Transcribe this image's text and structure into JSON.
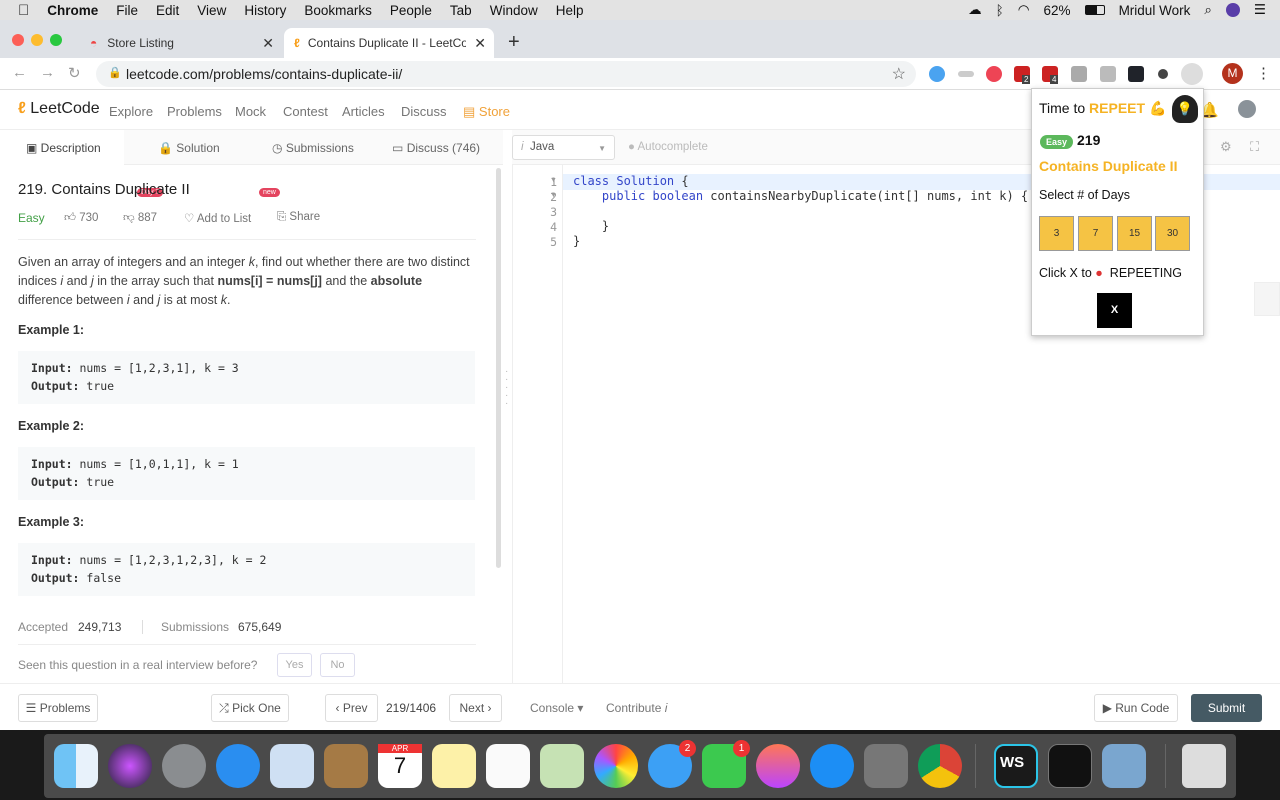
{
  "menubar": {
    "app": "Chrome",
    "items": [
      "File",
      "Edit",
      "View",
      "History",
      "Bookmarks",
      "People",
      "Tab",
      "Window",
      "Help"
    ],
    "battery": "62%",
    "user": "Mridul Work"
  },
  "browser": {
    "tabs": [
      {
        "title": "Store Listing"
      },
      {
        "title": "Contains Duplicate II - LeetCod"
      }
    ],
    "url": "leetcode.com/problems/contains-duplicate-ii/",
    "ext_badges": [
      "2",
      "4"
    ],
    "profile": "M"
  },
  "nav": {
    "logo": "LeetCode",
    "items": [
      "Explore",
      "Problems",
      "Mock",
      "Contest",
      "Articles",
      "Discuss",
      "Store"
    ],
    "explore_badge": "Day 7",
    "mock_badge": "new"
  },
  "problem_tabs": [
    "Description",
    "Solution",
    "Submissions",
    "Discuss (746)"
  ],
  "problem": {
    "title": "219. Contains Duplicate II",
    "difficulty": "Easy",
    "likes": "730",
    "dislikes": "887",
    "add_to_list": "Add to List",
    "share": "Share",
    "desc_1": "Given an array of integers and an integer ",
    "k": "k",
    "desc_2": ", find out whether there are two distinct indices ",
    "i": "i",
    "and": " and ",
    "j": "j",
    "desc_3": " in the array such that ",
    "eq": "nums[i] = nums[j]",
    "desc_4": " and the ",
    "abs": "absolute",
    "desc_5": " difference between ",
    "desc_6": " is at most ",
    "dot": ".",
    "examples": [
      {
        "title": "Example 1:",
        "input": "nums = [1,2,3,1], k = 3",
        "output": "true"
      },
      {
        "title": "Example 2:",
        "input": "nums = [1,0,1,1], k = 1",
        "output": "true"
      },
      {
        "title": "Example 3:",
        "input": "nums = [1,2,3,1,2,3], k = 2",
        "output": "false"
      }
    ],
    "input_label": "Input:",
    "output_label": "Output:",
    "accepted_label": "Accepted",
    "accepted": "249,713",
    "submissions_label": "Submissions",
    "submissions": "675,649",
    "interview_q": "Seen this question in a real interview before?",
    "yes": "Yes",
    "no": "No"
  },
  "editor": {
    "language": "Java",
    "autocomplete": "Autocomplete",
    "lines": [
      "1",
      "2",
      "3",
      "4",
      "5"
    ],
    "code": {
      "l1a": "class Solution",
      "l1b": " {",
      "l2a": "    public boolean",
      "l2b": " containsNearbyDuplicate(int[] nums, int k) {",
      "l4": "    }",
      "l5": "}"
    }
  },
  "bottom": {
    "problems": "Problems",
    "pick_one": "Pick One",
    "prev": "Prev",
    "page": "219/1406",
    "next": "Next",
    "console": "Console",
    "contribute": "Contribute",
    "run": "Run Code",
    "submit": "Submit"
  },
  "popup": {
    "title_a": "Time to ",
    "title_b": "REPEET",
    "difficulty": "Easy",
    "number": "219",
    "problem": "Contains Duplicate II",
    "select": "Select # of Days",
    "days": [
      "3",
      "7",
      "15",
      "30"
    ],
    "click_a": "Click X to",
    "click_b": "REPEETING",
    "close": "X",
    "accent": "#f5b324"
  },
  "dock": {
    "calendar_month": "APR",
    "calendar_day": "7",
    "messages_badge": "2",
    "facetime_badge": "1",
    "webstorm": "WS"
  },
  "colors": {
    "easy": "#5cb85c",
    "store": "#f0a23a",
    "submit": "#455a64"
  }
}
